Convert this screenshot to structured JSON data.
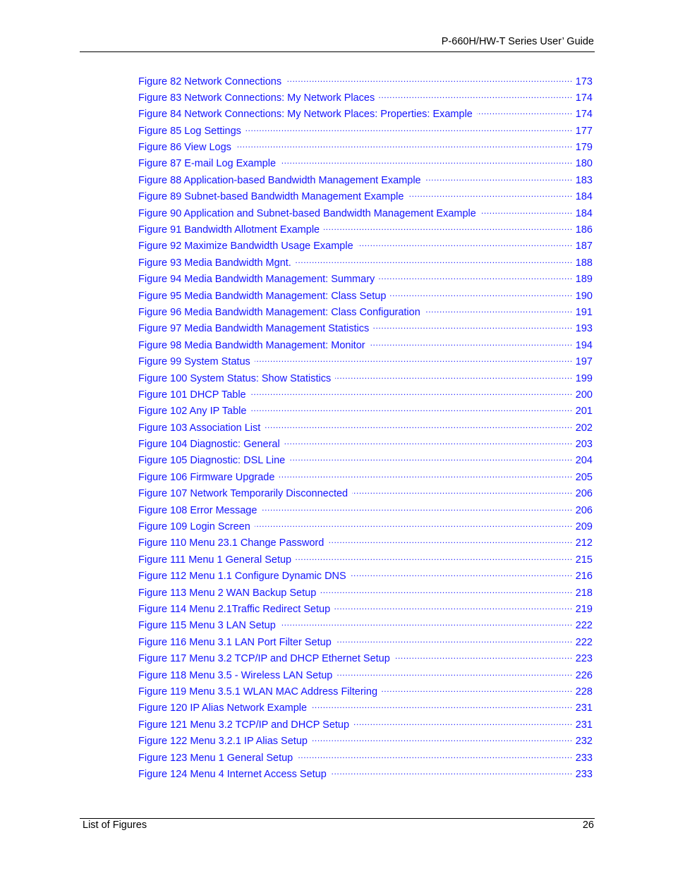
{
  "header": {
    "title": "P-660H/HW-T Series User’ Guide"
  },
  "toc": {
    "items": [
      {
        "label": "Figure 82 Network Connections",
        "page": "173"
      },
      {
        "label": "Figure 83 Network Connections: My Network Places",
        "page": "174"
      },
      {
        "label": "Figure 84 Network Connections: My Network Places: Properties: Example",
        "page": "174"
      },
      {
        "label": "Figure 85 Log Settings",
        "page": "177"
      },
      {
        "label": "Figure 86 View Logs",
        "page": "179"
      },
      {
        "label": "Figure 87 E-mail Log Example",
        "page": "180"
      },
      {
        "label": "Figure 88 Application-based Bandwidth Management Example",
        "page": "183"
      },
      {
        "label": "Figure 89 Subnet-based Bandwidth Management Example",
        "page": "184"
      },
      {
        "label": "Figure 90 Application and Subnet-based Bandwidth Management Example",
        "page": "184"
      },
      {
        "label": "Figure 91 Bandwidth Allotment Example",
        "page": "186"
      },
      {
        "label": "Figure 92 Maximize Bandwidth Usage Example",
        "page": "187"
      },
      {
        "label": "Figure 93 Media Bandwidth Mgnt.",
        "page": "188"
      },
      {
        "label": "Figure 94 Media Bandwidth Management: Summary",
        "page": "189"
      },
      {
        "label": "Figure 95 Media Bandwidth Management: Class Setup",
        "page": "190"
      },
      {
        "label": "Figure 96 Media Bandwidth Management: Class Configuration",
        "page": "191"
      },
      {
        "label": "Figure 97 Media Bandwidth Management Statistics",
        "page": "193"
      },
      {
        "label": "Figure 98 Media Bandwidth Management: Monitor",
        "page": "194"
      },
      {
        "label": "Figure 99 System Status",
        "page": "197"
      },
      {
        "label": "Figure 100 System Status: Show Statistics",
        "page": "199"
      },
      {
        "label": "Figure 101 DHCP Table",
        "page": "200"
      },
      {
        "label": "Figure 102 Any IP Table",
        "page": "201"
      },
      {
        "label": "Figure 103 Association List",
        "page": "202"
      },
      {
        "label": "Figure 104 Diagnostic: General",
        "page": "203"
      },
      {
        "label": "Figure 105 Diagnostic: DSL Line",
        "page": "204"
      },
      {
        "label": "Figure 106 Firmware Upgrade",
        "page": "205"
      },
      {
        "label": "Figure 107 Network Temporarily Disconnected",
        "page": "206"
      },
      {
        "label": "Figure 108 Error Message",
        "page": "206"
      },
      {
        "label": "Figure 109 Login Screen",
        "page": "209"
      },
      {
        "label": "Figure 110 Menu 23.1 Change Password",
        "page": "212"
      },
      {
        "label": "Figure 111 Menu 1 General Setup",
        "page": "215"
      },
      {
        "label": "Figure 112 Menu 1.1 Configure Dynamic DNS",
        "page": "216"
      },
      {
        "label": "Figure 113 Menu 2 WAN Backup Setup",
        "page": "218"
      },
      {
        "label": "Figure 114 Menu 2.1Traffic Redirect Setup",
        "page": "219"
      },
      {
        "label": "Figure 115 Menu 3 LAN Setup",
        "page": "222"
      },
      {
        "label": "Figure 116 Menu 3.1 LAN Port Filter Setup",
        "page": "222"
      },
      {
        "label": "Figure 117 Menu 3.2 TCP/IP and DHCP Ethernet Setup",
        "page": "223"
      },
      {
        "label": "Figure 118  Menu 3.5 - Wireless LAN Setup",
        "page": "226"
      },
      {
        "label": "Figure 119 Menu 3.5.1 WLAN MAC Address Filtering",
        "page": "228"
      },
      {
        "label": "Figure 120 IP Alias Network Example",
        "page": "231"
      },
      {
        "label": "Figure 121 Menu 3.2 TCP/IP and DHCP Setup",
        "page": "231"
      },
      {
        "label": "Figure 122 Menu 3.2.1 IP Alias Setup",
        "page": "232"
      },
      {
        "label": "Figure 123 Menu 1 General Setup",
        "page": "233"
      },
      {
        "label": "Figure 124 Menu 4 Internet Access Setup",
        "page": "233"
      }
    ]
  },
  "footer": {
    "section": "List of Figures",
    "page_number": "26"
  },
  "colors": {
    "link": "#1414ff",
    "text": "#000000"
  }
}
